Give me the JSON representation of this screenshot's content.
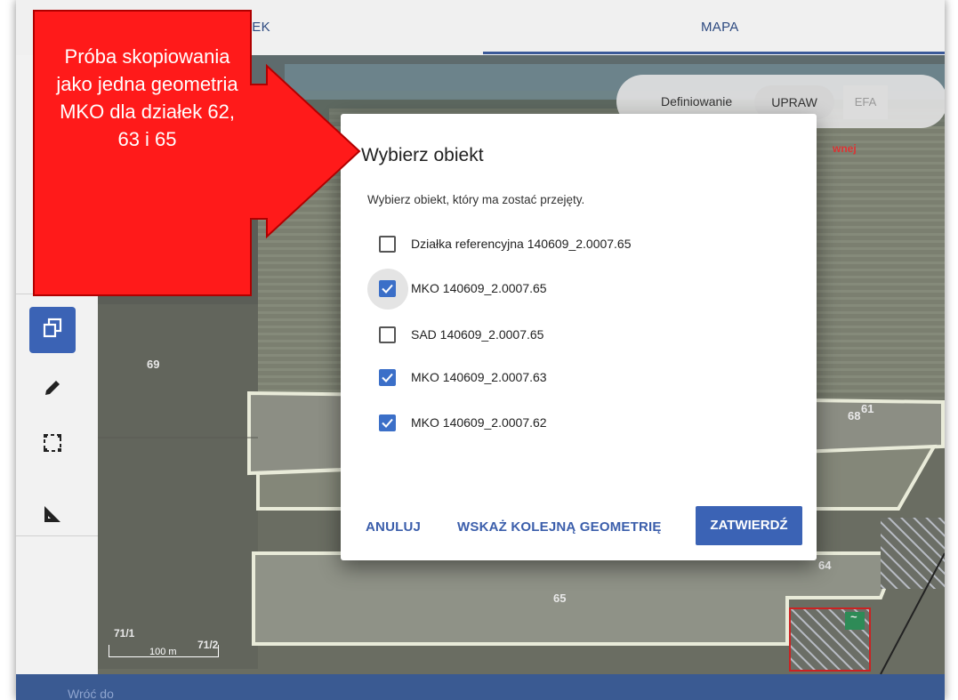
{
  "tabs": [
    {
      "label": "SEK"
    },
    {
      "label": "MAPA"
    }
  ],
  "toggle": {
    "label": "Definiowanie",
    "upraw": "UPRAW",
    "efa": "EFA"
  },
  "map": {
    "parcel_labels": [
      "69",
      "65",
      "68",
      "61",
      "64",
      "71/1",
      "71/2",
      "wnej",
      "~"
    ],
    "scale_label": "100 m"
  },
  "footer": {
    "text": "Wróć do"
  },
  "dialog": {
    "title": "Wybierz obiekt",
    "subtitle": "Wybierz obiekt, który ma zostać przejęty.",
    "options": [
      {
        "label": "Działka referencyjna 140609_2.0007.65",
        "checked": false
      },
      {
        "label": "MKO 140609_2.0007.65",
        "checked": true
      },
      {
        "label": "SAD 140609_2.0007.65",
        "checked": false
      },
      {
        "label": "MKO 140609_2.0007.63",
        "checked": true
      },
      {
        "label": "MKO 140609_2.0007.62",
        "checked": true
      }
    ],
    "cancel": "ANULUJ",
    "next": "WSKAŻ KOLEJNĄ GEOMETRIĘ",
    "confirm": "ZATWIERDŹ"
  },
  "callout": {
    "text": "Próba skopiowania jako jedna geometria MKO dla działek 62, 63 i 65"
  },
  "colors": {
    "accent": "#3b63b5",
    "callout": "#ff1a1a",
    "footer": "#3a5a92"
  },
  "icons": [
    "copy-geometry-icon",
    "pencil-icon",
    "select-area-icon",
    "measure-icon",
    "check-icon"
  ]
}
